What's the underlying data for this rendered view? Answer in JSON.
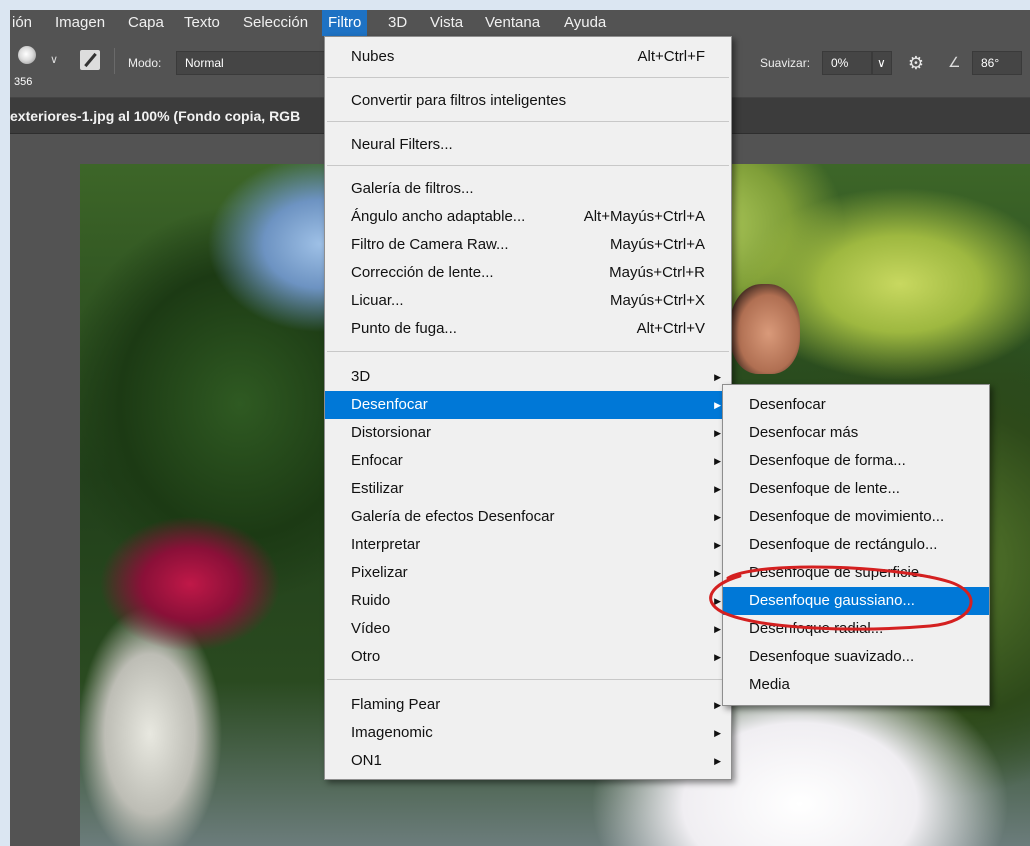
{
  "menubar": {
    "items": [
      "ión",
      "Imagen",
      "Capa",
      "Texto",
      "Selección",
      "Filtro",
      "3D",
      "Vista",
      "Ventana",
      "Ayuda"
    ],
    "active": "Filtro"
  },
  "options_bar": {
    "brush_size": "356",
    "mode_label": "Modo:",
    "mode_value": "Normal",
    "smoothing_label": "Suavizar:",
    "smoothing_value": "0%",
    "angle_value": "86°"
  },
  "document_tab": {
    "title": "exteriores-1.jpg al 100% (Fondo copia, RGB"
  },
  "filter_menu": {
    "items": [
      {
        "label": "Nubes",
        "shortcut": "Alt+Ctrl+F"
      },
      {
        "label": "Convertir para filtros inteligentes",
        "shortcut": ""
      },
      {
        "label": "Neural Filters...",
        "shortcut": ""
      },
      {
        "label": "Galería de filtros...",
        "shortcut": ""
      },
      {
        "label": "Ángulo ancho adaptable...",
        "shortcut": "Alt+Mayús+Ctrl+A"
      },
      {
        "label": "Filtro de Camera Raw...",
        "shortcut": "Mayús+Ctrl+A"
      },
      {
        "label": "Corrección de lente...",
        "shortcut": "Mayús+Ctrl+R"
      },
      {
        "label": "Licuar...",
        "shortcut": "Mayús+Ctrl+X"
      },
      {
        "label": "Punto de fuga...",
        "shortcut": "Alt+Ctrl+V"
      },
      {
        "label": "3D",
        "shortcut": ""
      },
      {
        "label": "Desenfocar",
        "shortcut": ""
      },
      {
        "label": "Distorsionar",
        "shortcut": ""
      },
      {
        "label": "Enfocar",
        "shortcut": ""
      },
      {
        "label": "Estilizar",
        "shortcut": ""
      },
      {
        "label": "Galería de efectos Desenfocar",
        "shortcut": ""
      },
      {
        "label": "Interpretar",
        "shortcut": ""
      },
      {
        "label": "Pixelizar",
        "shortcut": ""
      },
      {
        "label": "Ruido",
        "shortcut": ""
      },
      {
        "label": "Vídeo",
        "shortcut": ""
      },
      {
        "label": "Otro",
        "shortcut": ""
      },
      {
        "label": "Flaming Pear",
        "shortcut": ""
      },
      {
        "label": "Imagenomic",
        "shortcut": ""
      },
      {
        "label": "ON1",
        "shortcut": ""
      }
    ]
  },
  "blur_submenu": {
    "items": [
      "Desenfocar",
      "Desenfocar más",
      "Desenfoque de forma...",
      "Desenfoque de lente...",
      "Desenfoque de movimiento...",
      "Desenfoque de rectángulo...",
      "Desenfoque de superficie...",
      "Desenfoque gaussiano...",
      "Desenfoque radial...",
      "Desenfoque suavizado...",
      "Media"
    ],
    "highlighted": "Desenfoque gaussiano..."
  },
  "colors": {
    "menu_highlight": "#0078d7",
    "menubar_active": "#1e72c4",
    "annotation_circle": "#d42020"
  }
}
